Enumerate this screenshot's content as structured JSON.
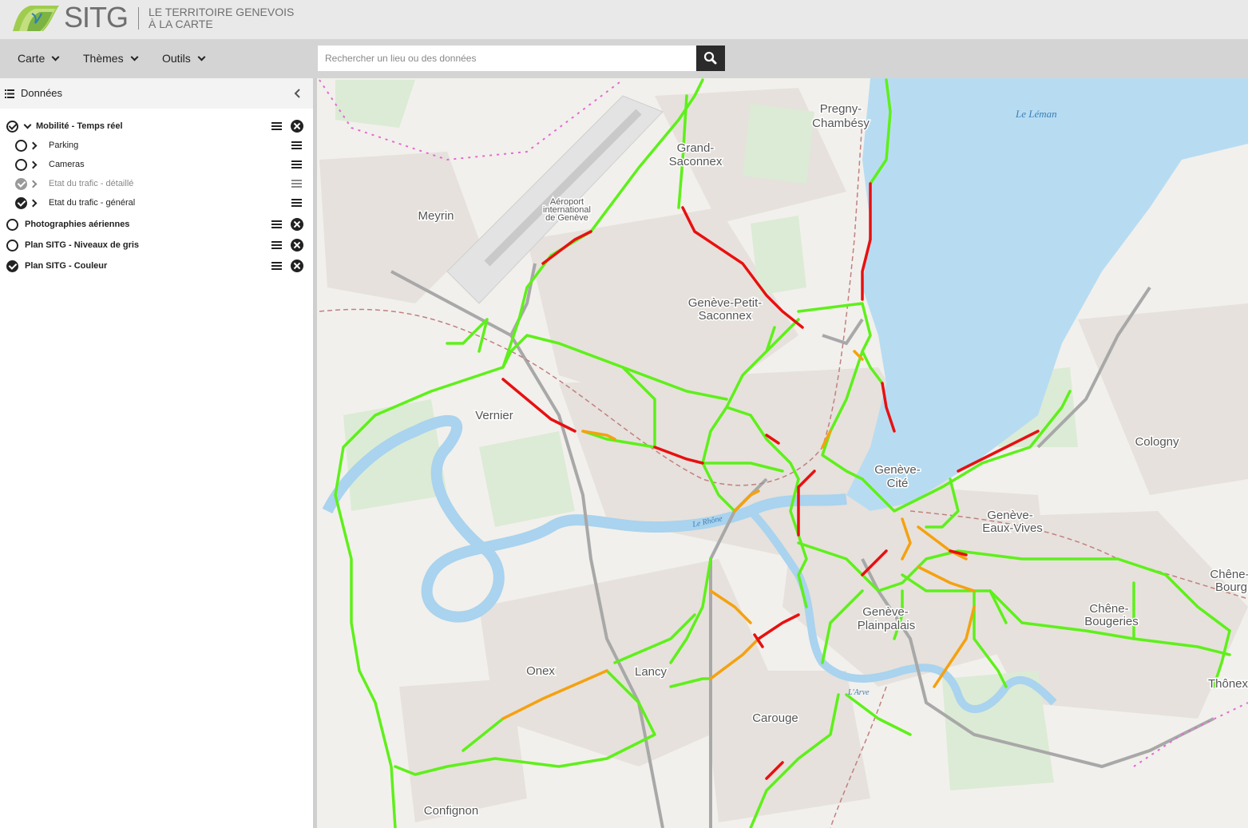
{
  "header": {
    "brand": "SITG",
    "tagline_line1": "LE TERRITOIRE GENEVOIS",
    "tagline_line2": "À LA CARTE"
  },
  "toolbar": {
    "menus": [
      {
        "label": "Carte"
      },
      {
        "label": "Thèmes"
      },
      {
        "label": "Outils"
      }
    ],
    "search": {
      "placeholder": "Rechercher un lieu ou des données",
      "value": ""
    }
  },
  "panel": {
    "title": "Données",
    "layers": [
      {
        "label": "Mobilité - Temps réel",
        "checked": true,
        "expanded": true,
        "group": true
      },
      {
        "label": "Parking",
        "checked": false
      },
      {
        "label": "Cameras",
        "checked": false
      },
      {
        "label": "Etat du trafic - détaillé",
        "checked": true,
        "disabled": true
      },
      {
        "label": "Etat du trafic - général",
        "checked": true
      },
      {
        "label": "Photographies aériennes",
        "checked": false,
        "group": true
      },
      {
        "label": "Plan SITG - Niveaux de gris",
        "checked": false,
        "group": true
      },
      {
        "label": "Plan SITG - Couleur",
        "checked": true,
        "group": true
      }
    ]
  },
  "map": {
    "labels": {
      "pregny": "Pregny-",
      "chambesy": "Chambésy",
      "leman": "Le Léman",
      "grand": "Grand-",
      "saconnex": "Saconnex",
      "meyrin": "Meyrin",
      "aeroport1": "Aéroport",
      "aeroport2": "international",
      "aeroport3": "de Genève",
      "petit1": "Genève-Petit-",
      "petit2": "Saconnex",
      "vernier": "Vernier",
      "cite1": "Genève-",
      "cite2": "Cité",
      "cologny": "Cologny",
      "eaux1": "Genève-",
      "eaux2": "Eaux-Vives",
      "rhone": "Le Rhône",
      "chenebourg1": "Chêne-",
      "chenebourg2": "Bourg",
      "plainpalais1": "Genève-",
      "plainpalais2": "Plainpalais",
      "chenebougeries1": "Chêne-",
      "chenebougeries2": "Bougeries",
      "onex": "Onex",
      "lancy": "Lancy",
      "thonex": "Thônex",
      "arve": "L'Arve",
      "carouge": "Carouge",
      "confignon": "Confignon"
    },
    "colors": {
      "fluid": "#5ef01a",
      "slow": "#f5a10f",
      "jammed": "#e81010",
      "water": "#b7dcf2",
      "river": "#a9d3ee",
      "background": "#f2f0ec"
    }
  }
}
